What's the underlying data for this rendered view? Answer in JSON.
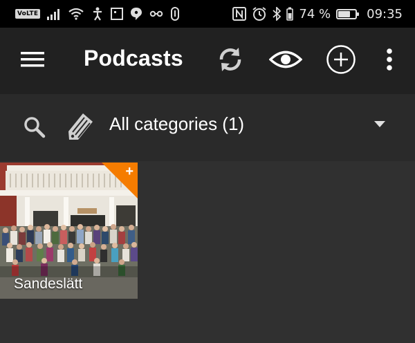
{
  "status_bar": {
    "volte": "VoLTE",
    "battery_pct": "74 %",
    "battery_level": 0.74,
    "time": "09:35",
    "icons_left": [
      "volte-icon",
      "signal-icon",
      "wifi-icon",
      "accessibility-icon",
      "square-icon",
      "chat-icon",
      "infinity-icon",
      "link-icon"
    ],
    "icons_right": [
      "nfc-icon",
      "alarm-icon",
      "bluetooth-icon",
      "battery-vibrate-icon",
      "battery-icon"
    ]
  },
  "app_bar": {
    "title": "Podcasts",
    "actions": [
      "refresh-icon",
      "eye-icon",
      "add-circle-icon",
      "more-vert-icon"
    ]
  },
  "filter_bar": {
    "category_label": "All categories (1)"
  },
  "podcasts": [
    {
      "name": "Sandeslätt",
      "badge": "+"
    }
  ],
  "colors": {
    "background": "#303030",
    "app_bar": "#212121",
    "filter_bar": "#2a2a2a",
    "status_bar": "#000000",
    "badge": "#f57c00"
  }
}
